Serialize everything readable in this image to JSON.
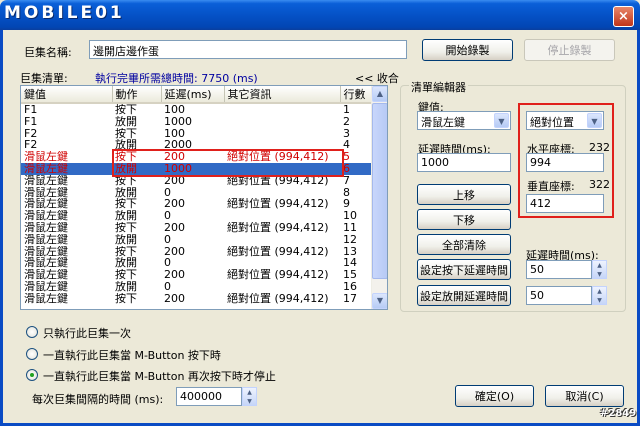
{
  "logo": "MOBILE01",
  "close_symbol": "×",
  "macro_name": {
    "label": "巨集名稱:",
    "value": "邊開店邊作蛋"
  },
  "buttons": {
    "start_record": "開始錄製",
    "stop_record": "停止錄製",
    "ok": "確定(O)",
    "cancel": "取消(C)"
  },
  "macro_list": {
    "label": "巨集清單:",
    "exec_time": "執行完畢所需總時間: 7750 (ms)",
    "collapse": "<< 收合",
    "columns": [
      "鍵值",
      "動作",
      "延遲(ms)",
      "其它資訊",
      "行數"
    ],
    "rows": [
      [
        "F1",
        "按下",
        "100",
        "",
        "1"
      ],
      [
        "F1",
        "放開",
        "1000",
        "",
        "2"
      ],
      [
        "F2",
        "按下",
        "100",
        "",
        "3"
      ],
      [
        "F2",
        "放開",
        "2000",
        "",
        "4"
      ],
      [
        "滑鼠左鍵",
        "按下",
        "200",
        "絕對位置 (994,412)",
        "5"
      ],
      [
        "滑鼠左鍵",
        "放開",
        "1000",
        "",
        "6"
      ],
      [
        "滑鼠左鍵",
        "按下",
        "200",
        "絕對位置 (994,412)",
        "7"
      ],
      [
        "滑鼠左鍵",
        "放開",
        "0",
        "",
        "8"
      ],
      [
        "滑鼠左鍵",
        "按下",
        "200",
        "絕對位置 (994,412)",
        "9"
      ],
      [
        "滑鼠左鍵",
        "放開",
        "0",
        "",
        "10"
      ],
      [
        "滑鼠左鍵",
        "按下",
        "200",
        "絕對位置 (994,412)",
        "11"
      ],
      [
        "滑鼠左鍵",
        "放開",
        "0",
        "",
        "12"
      ],
      [
        "滑鼠左鍵",
        "按下",
        "200",
        "絕對位置 (994,412)",
        "13"
      ],
      [
        "滑鼠左鍵",
        "放開",
        "0",
        "",
        "14"
      ],
      [
        "滑鼠左鍵",
        "按下",
        "200",
        "絕對位置 (994,412)",
        "15"
      ],
      [
        "滑鼠左鍵",
        "放開",
        "0",
        "",
        "16"
      ],
      [
        "滑鼠左鍵",
        "按下",
        "200",
        "絕對位置 (994,412)",
        "17"
      ]
    ],
    "highlight_rows": [
      4
    ],
    "selected_row": 5
  },
  "editor": {
    "title": "清單編輯器",
    "key_label": "鍵值:",
    "key_value": "滑鼠左鍵",
    "delay_label": "延遲時間(ms):",
    "delay_value": "1000",
    "move_up": "上移",
    "move_down": "下移",
    "clear_all": "全部清除",
    "set_press_delay": "設定按下延遲時間",
    "set_release_delay": "設定放開延遲時間",
    "position_type": "絕對位置",
    "x_label": "水平座標:",
    "x_hint": "232",
    "x_value": "994",
    "y_label": "垂直座標:",
    "y_hint": "322",
    "y_value": "412",
    "delay2_label": "延遲時間(ms):",
    "press_delay_value": "50",
    "release_delay_value": "50"
  },
  "options": {
    "run_once": "只執行此巨集一次",
    "run_while_held": "一直執行此巨集當 M-Button 按下時",
    "run_until_pressed_again": "一直執行此巨集當 M-Button 再次按下時才停止",
    "interval_label": "每次巨集間隔的時間 (ms):",
    "interval_value": "400000",
    "selected_option": "run_until_pressed_again"
  },
  "watermark": "#2849",
  "colors": {
    "title_blue": "#0552c7",
    "highlight_red": "#e0201b",
    "selection_blue": "#316ac5",
    "exec_time_blue": "#0000a0"
  }
}
